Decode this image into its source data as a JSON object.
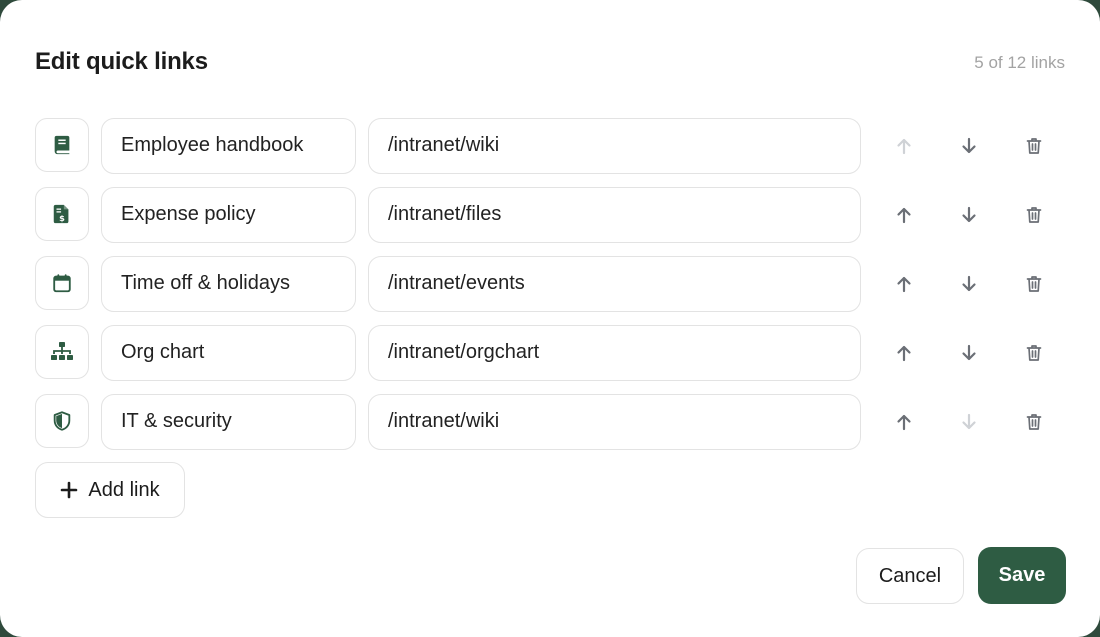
{
  "dialog": {
    "title": "Edit quick links",
    "counter": "5 of 12 links"
  },
  "links": [
    {
      "icon": "book-icon",
      "name": "Employee handbook",
      "url": "/intranet/wiki",
      "up_enabled": false,
      "down_enabled": true
    },
    {
      "icon": "invoice-dollar-icon",
      "name": "Expense policy",
      "url": "/intranet/files",
      "up_enabled": true,
      "down_enabled": true
    },
    {
      "icon": "calendar-icon",
      "name": "Time off & holidays",
      "url": "/intranet/events",
      "up_enabled": true,
      "down_enabled": true
    },
    {
      "icon": "org-chart-icon",
      "name": "Org chart",
      "url": "/intranet/orgchart",
      "up_enabled": true,
      "down_enabled": true
    },
    {
      "icon": "shield-icon",
      "name": "IT & security",
      "url": "/intranet/wiki",
      "up_enabled": true,
      "down_enabled": false
    }
  ],
  "actions": {
    "add_label": "Add link",
    "cancel_label": "Cancel",
    "save_label": "Save"
  },
  "colors": {
    "accent": "#2e5c43",
    "icon": "#2e5c43",
    "action_enabled": "#6b6f76",
    "action_disabled": "#cfd2d6"
  }
}
